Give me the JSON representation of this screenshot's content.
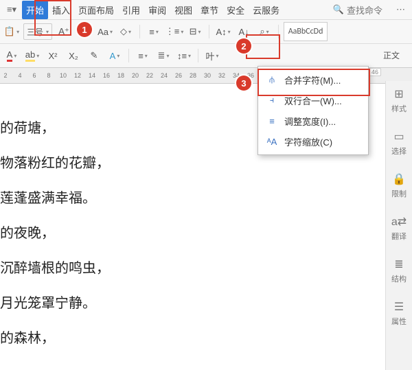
{
  "menubar": {
    "tabs": [
      "开始",
      "插入",
      "页面布局",
      "引用",
      "审阅",
      "视图",
      "章节",
      "安全",
      "云服务"
    ],
    "active_index": 0,
    "search_placeholder": "查找命令"
  },
  "toolbar": {
    "font_size": "三号",
    "style_preview": "AaBbCcDd",
    "style_name": "正文"
  },
  "ruler": {
    "start": 2,
    "end": 46,
    "step": 2,
    "page_badge": "46"
  },
  "char_menu": {
    "items": [
      {
        "icon": "merge",
        "label": "合并字符(M)..."
      },
      {
        "icon": "two-line",
        "label": "双行合一(W)..."
      },
      {
        "icon": "width",
        "label": "调整宽度(I)..."
      },
      {
        "icon": "scale",
        "label": "字符缩放(C)"
      }
    ],
    "highlight_index": 1
  },
  "document": {
    "lines": [
      "的荷塘，",
      "物落粉红的花瓣，",
      "莲蓬盛满幸福。",
      "的夜晚，",
      "沉醉墙根的鸣虫，",
      "月光笼罩宁静。",
      "的森林，"
    ]
  },
  "right_pane": {
    "items": [
      {
        "icon": "⊞",
        "label": "样式"
      },
      {
        "icon": "▭",
        "label": "选择"
      },
      {
        "icon": "🔒",
        "label": "限制"
      },
      {
        "icon": "a⇄",
        "label": "翻译"
      },
      {
        "icon": "≣",
        "label": "结构"
      },
      {
        "icon": "☰",
        "label": "属性"
      }
    ]
  },
  "callouts": {
    "c1": "1",
    "c2": "2",
    "c3": "3"
  }
}
